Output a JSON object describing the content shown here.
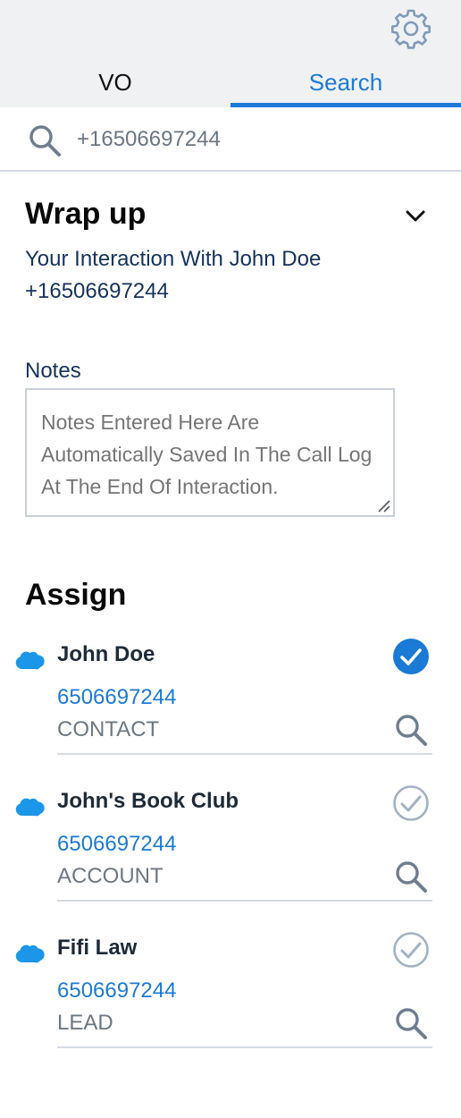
{
  "header": {
    "settings_icon": "gear-icon",
    "tabs": [
      {
        "label": "VO",
        "active": false
      },
      {
        "label": "Search",
        "active": true
      }
    ]
  },
  "search": {
    "icon": "search-icon",
    "value": "+16506697244"
  },
  "wrapup": {
    "title": "Wrap up",
    "subtitle_line1": "Your Interaction With John Doe",
    "subtitle_line2": "+16506697244",
    "collapse_icon": "chevron-down-icon"
  },
  "notes": {
    "label": "Notes",
    "placeholder": "Notes Entered Here Are Automatically Saved In The Call Log At The End Of Interaction."
  },
  "assign": {
    "title": "Assign",
    "records": [
      {
        "name": "John Doe",
        "phone": "6506697244",
        "type": "CONTACT",
        "selected": true
      },
      {
        "name": "John's Book Club",
        "phone": "6506697244",
        "type": "ACCOUNT",
        "selected": false
      },
      {
        "name": "Fifi Law",
        "phone": "6506697244",
        "type": "LEAD",
        "selected": false
      }
    ]
  },
  "colors": {
    "accent": "#1b7ad6",
    "header_bg": "#f0f1f3",
    "text_dark": "#16325c",
    "salesforce_blue": "#1b96e8",
    "check_inactive": "#a3b2c2"
  }
}
